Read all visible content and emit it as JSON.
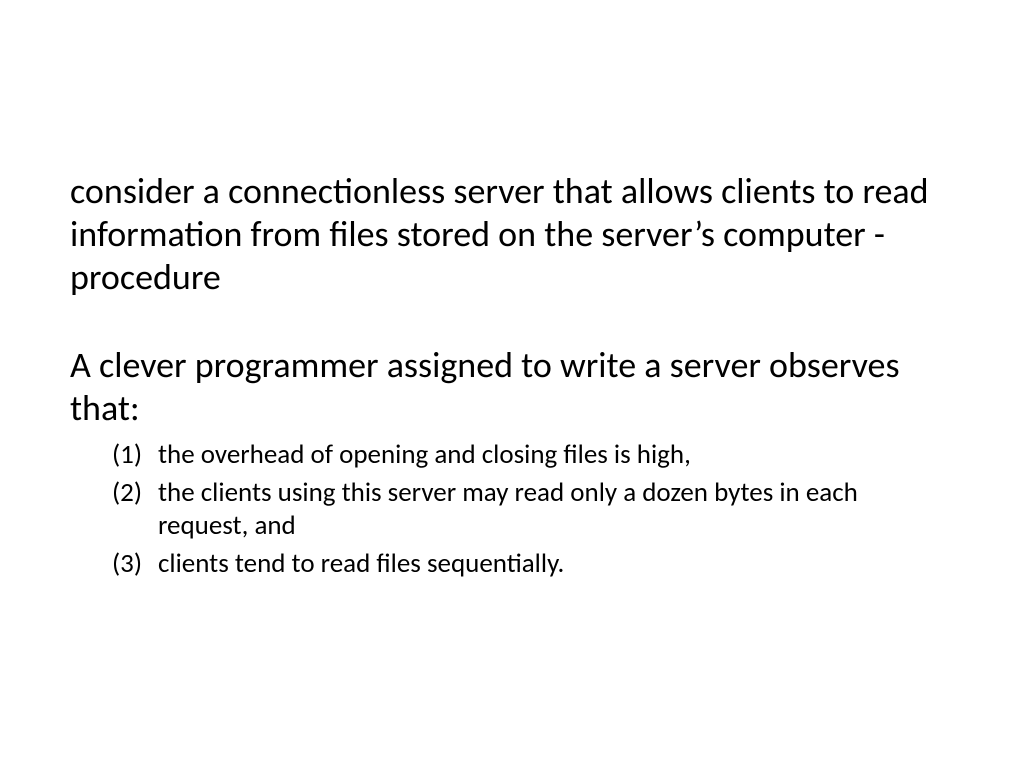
{
  "slide": {
    "paragraph1": "consider a connectionless server that allows clients to read information from files stored on the server’s computer - procedure",
    "paragraph2": "A clever programmer assigned to write a server observes that:",
    "items": [
      {
        "marker": "(1)",
        "text": "the overhead of opening and closing files is high,"
      },
      {
        "marker": "(2)",
        "text": "the clients using this server may read only a dozen bytes in each request, and"
      },
      {
        "marker": "(3)",
        "text": "clients tend to read files sequentially."
      }
    ]
  }
}
